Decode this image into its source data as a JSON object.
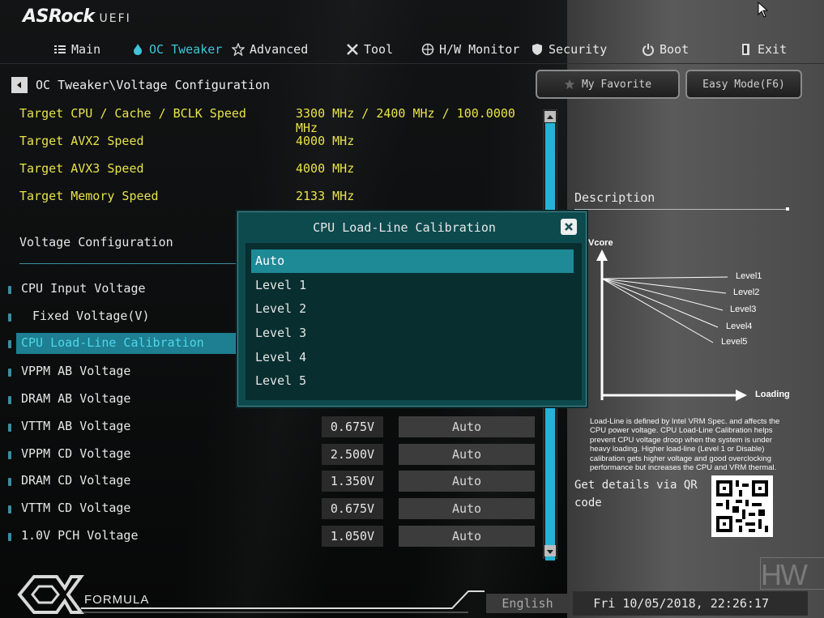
{
  "brand": {
    "name": "ASRock",
    "suffix": "UEFI"
  },
  "nav": {
    "items": [
      {
        "label": "Main",
        "icon": "list-icon"
      },
      {
        "label": "OC Tweaker",
        "icon": "flame-icon",
        "active": true
      },
      {
        "label": "Advanced",
        "icon": "star-icon"
      },
      {
        "label": "Tool",
        "icon": "tools-icon"
      },
      {
        "label": "H/W Monitor",
        "icon": "monitor-icon"
      },
      {
        "label": "Security",
        "icon": "shield-icon"
      },
      {
        "label": "Boot",
        "icon": "power-icon"
      },
      {
        "label": "Exit",
        "icon": "exit-icon"
      }
    ]
  },
  "breadcrumb": "OC Tweaker\\Voltage Configuration",
  "buttons": {
    "favorite": "My Favorite",
    "easy_mode": "Easy Mode(F6)"
  },
  "info_rows": [
    {
      "label": "Target CPU / Cache / BCLK Speed",
      "value": "3300 MHz / 2400 MHz / 100.0000 MHz"
    },
    {
      "label": "Target AVX2 Speed",
      "value": "4000 MHz"
    },
    {
      "label": "Target AVX3 Speed",
      "value": "4000 MHz"
    },
    {
      "label": "Target Memory Speed",
      "value": "2133 MHz"
    }
  ],
  "section_title": "Voltage Configuration",
  "settings": [
    {
      "label": "CPU Input Voltage"
    },
    {
      "label": "Fixed Voltage(V)"
    },
    {
      "label": "CPU Load-Line Calibration",
      "selected": true
    },
    {
      "label": "VPPM AB  Voltage"
    },
    {
      "label": "DRAM AB  Voltage"
    },
    {
      "label": "VTTM AB  Voltage",
      "value": "0.675V",
      "mode": "Auto"
    },
    {
      "label": "VPPM CD  Voltage",
      "value": "2.500V",
      "mode": "Auto"
    },
    {
      "label": "DRAM CD  Voltage",
      "value": "1.350V",
      "mode": "Auto"
    },
    {
      "label": "VTTM CD  Voltage",
      "value": "0.675V",
      "mode": "Auto"
    },
    {
      "label": "1.0V PCH Voltage",
      "value": "1.050V",
      "mode": "Auto"
    }
  ],
  "modal": {
    "title": "CPU Load-Line Calibration",
    "options": [
      "Auto",
      "Level 1",
      "Level 2",
      "Level 3",
      "Level 4",
      "Level 5"
    ],
    "selected": "Auto"
  },
  "description": {
    "title": "Description",
    "chart_labels": {
      "y": "Vcore",
      "x": "Loading",
      "levels": [
        "Level1",
        "Level2",
        "Level3",
        "Level4",
        "Level5"
      ]
    },
    "text": "Load-Line is defined by Intel VRM Spec. and affects the CPU power voltage. CPU Load-Line Calibration helps prevent CPU voltage droop when the system is under heavy loading. Higher load-line (Level 1 or Disable) calibration gets higher voltage and good overclocking performance but increases the CPU and VRM thermal.",
    "qr_text": "Get details via QR code"
  },
  "footer": {
    "brand": "FORMULA",
    "language": "English",
    "datetime": "Fri 10/05/2018, 22:26:17"
  }
}
